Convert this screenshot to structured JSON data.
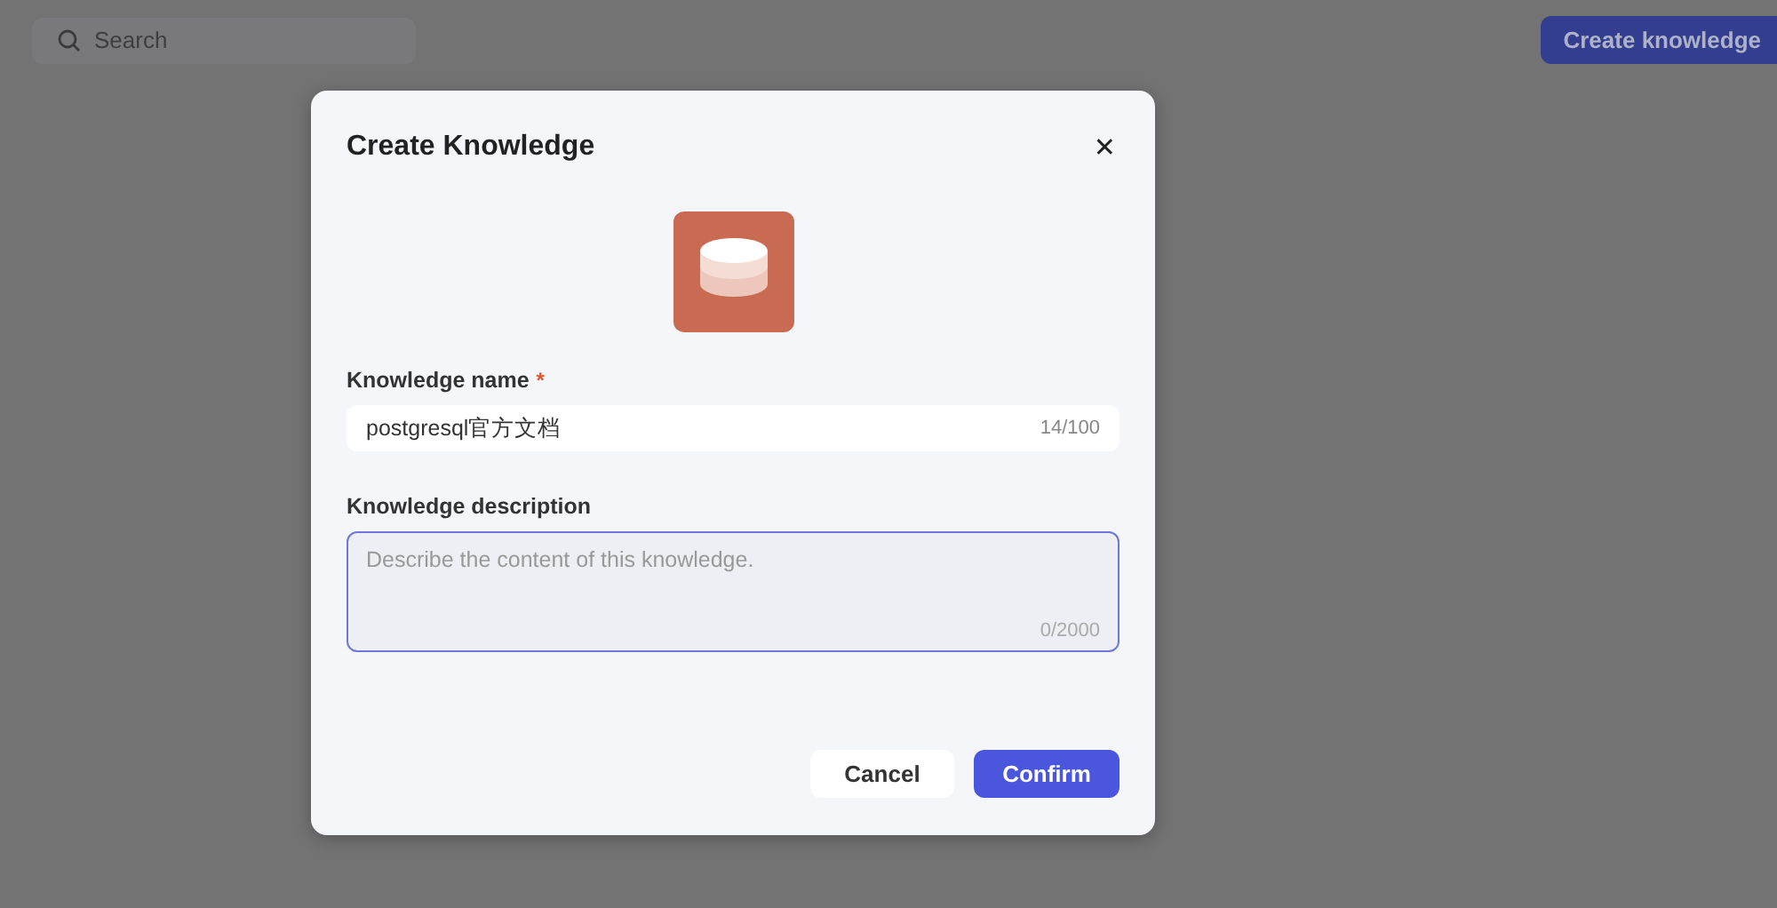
{
  "header": {
    "search": {
      "placeholder": "Search"
    },
    "create_button": "Create knowledge"
  },
  "dialog": {
    "title": "Create Knowledge",
    "close": "✕",
    "fields": [
      {
        "kind": "input",
        "label": "Knowledge name",
        "required_mark": "*",
        "value": "postgresql官方文档",
        "counter": "14/100",
        "focused": false
      },
      {
        "kind": "textarea",
        "label": "Knowledge description",
        "placeholder": "Describe the content of this knowledge.",
        "counter": "0/2000",
        "focused": true
      }
    ],
    "buttons": [
      {
        "kind": "secondary",
        "label": "Cancel"
      },
      {
        "kind": "primary",
        "label": "Confirm"
      }
    ]
  }
}
